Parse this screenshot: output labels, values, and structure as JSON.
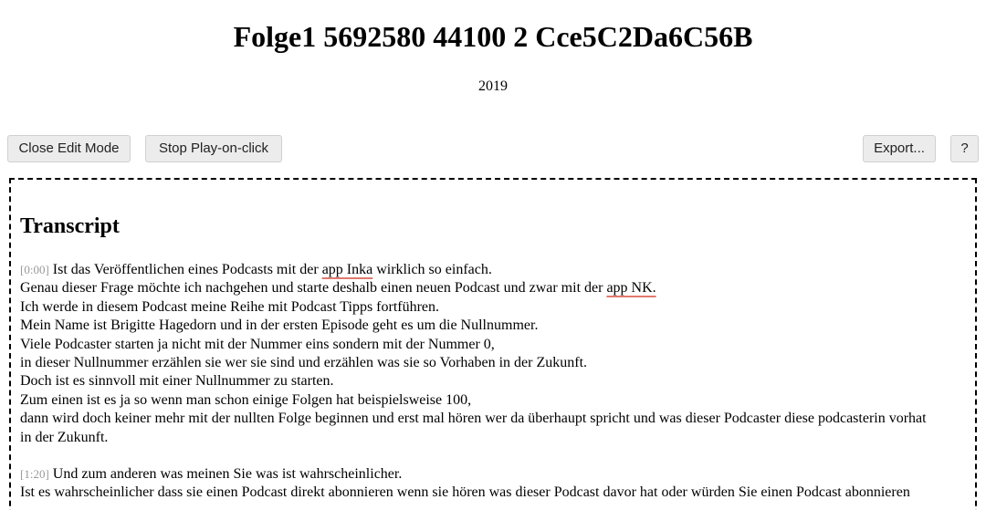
{
  "header": {
    "title": "Folge1 5692580 44100 2 Cce5C2Da6C56B",
    "year": "2019"
  },
  "toolbar": {
    "close_edit_label": "Close Edit Mode",
    "stop_play_label": "Stop Play-on-click",
    "export_label": "Export...",
    "help_label": "?"
  },
  "transcript": {
    "heading": "Transcript",
    "p1": {
      "timestamp": "[0:00]",
      "l1_pre": "Ist das Veröffentlichen eines Podcasts mit der ",
      "l1_flag": "app Inka",
      "l1_post": " wirklich so einfach.",
      "l2_pre": "Genau dieser Frage möchte ich nachgehen und starte deshalb einen neuen Podcast und zwar mit der ",
      "l2_flag": "app NK.",
      "l3": "Ich werde in diesem Podcast meine Reihe mit Podcast Tipps fortführen.",
      "l4": "Mein Name ist Brigitte Hagedorn und in der ersten Episode geht es um die Nullnummer.",
      "l5": "Viele Podcaster starten ja nicht mit der Nummer eins sondern mit der Nummer 0,",
      "l6": "in dieser Nullnummer erzählen sie wer sie sind und erzählen was sie so Vorhaben in der Zukunft.",
      "l7": "Doch ist es sinnvoll mit einer Nullnummer zu starten.",
      "l8": "Zum einen ist es ja so wenn man schon einige Folgen hat beispielsweise 100,",
      "l9": "dann wird doch keiner mehr mit der nullten Folge beginnen und erst mal hören wer da überhaupt spricht und was dieser Podcaster diese podcasterin vorhat in der Zukunft."
    },
    "p2": {
      "timestamp": "[1:20]",
      "l1": "Und zum anderen was meinen Sie was ist wahrscheinlicher.",
      "l2": "Ist es wahrscheinlicher dass sie einen Podcast direkt abonnieren wenn sie hören was dieser Podcast davor hat oder würden Sie einen Podcast abonnieren"
    }
  }
}
